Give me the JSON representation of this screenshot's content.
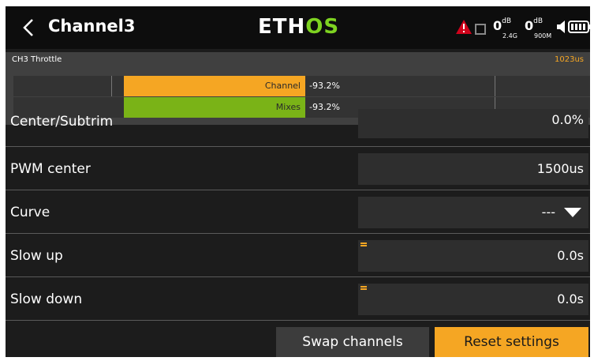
{
  "header": {
    "title": "Channel3",
    "logo_prefix": "ETH",
    "logo_highlight": "OS",
    "rssi": [
      {
        "value": "0",
        "unit": "dB",
        "band": "2.4G"
      },
      {
        "value": "0",
        "unit": "dB",
        "band": "900M"
      }
    ],
    "icons": [
      "back-chevron-icon",
      "warning-icon",
      "sd-card-icon",
      "speaker-icon",
      "battery-icon"
    ],
    "colors": {
      "logo_accent": "#7ed321",
      "warning": "#d0021b"
    }
  },
  "monitor": {
    "label": "CH3  Throttle",
    "value": "1023us",
    "bars": [
      {
        "name": "Channel",
        "value": "-93.2%",
        "color": "#f5a623"
      },
      {
        "name": "Mixes",
        "value": "-93.2%",
        "color": "#7ab317"
      }
    ]
  },
  "settings": {
    "center": {
      "label": "Center/Subtrim",
      "value": "0.0%"
    },
    "pwm": {
      "label": "PWM center",
      "value": "1500us"
    },
    "curve": {
      "label": "Curve",
      "value": "---"
    },
    "slow_up": {
      "label": "Slow up",
      "value": "0.0s"
    },
    "slow_down": {
      "label": "Slow down",
      "value": "0.0s"
    }
  },
  "buttons": {
    "swap": "Swap channels",
    "reset": "Reset settings"
  },
  "accent_color": "#f5a623"
}
